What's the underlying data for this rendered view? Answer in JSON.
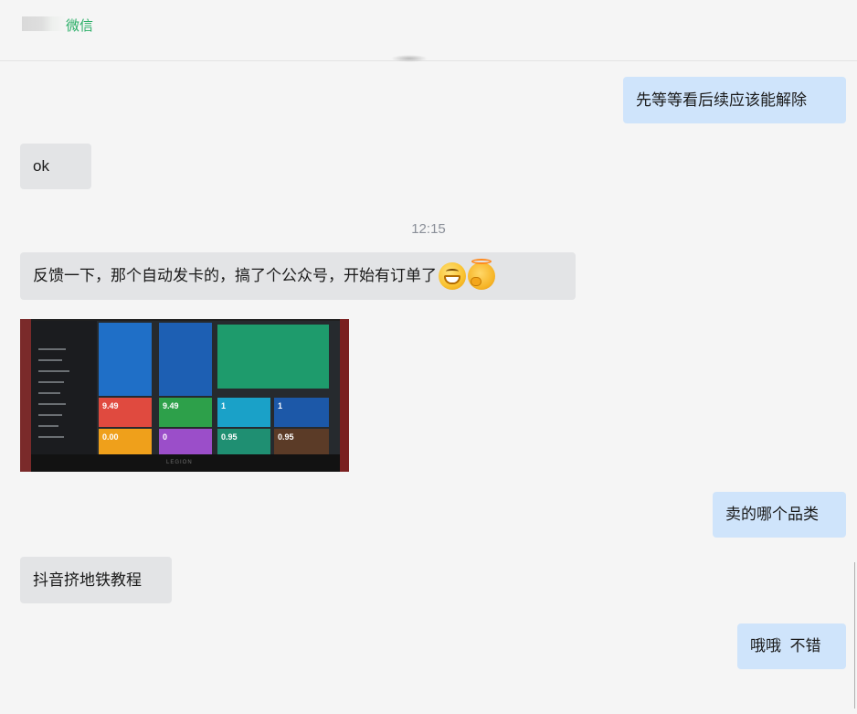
{
  "header": {
    "app_name": "微信"
  },
  "messages": [
    {
      "side": "me",
      "text": "先等等看后续应该能解除"
    },
    {
      "side": "them",
      "text": "ok"
    },
    {
      "side": "them",
      "text": "反馈一下，那个自动发卡的，搞了个公众号，开始有订单了",
      "emojis": [
        "grinning-face-emoji",
        "halo-face-emoji"
      ]
    },
    {
      "side": "them",
      "type": "image"
    },
    {
      "side": "me",
      "text": "卖的哪个品类"
    },
    {
      "side": "them",
      "text": "抖音挤地铁教程"
    },
    {
      "side": "me",
      "text": "哦哦  不错"
    }
  ],
  "timestamp": "12:15",
  "photo": {
    "tiles": [
      "9.49",
      "9.49",
      "1",
      "1",
      "0.00",
      "0",
      "0.95",
      "0.95"
    ],
    "monitor_brand": "LEGION"
  },
  "colors": {
    "my_bubble": "#cfe4fb",
    "their_bubble": "#e3e4e6",
    "app_green": "#2aae67"
  }
}
